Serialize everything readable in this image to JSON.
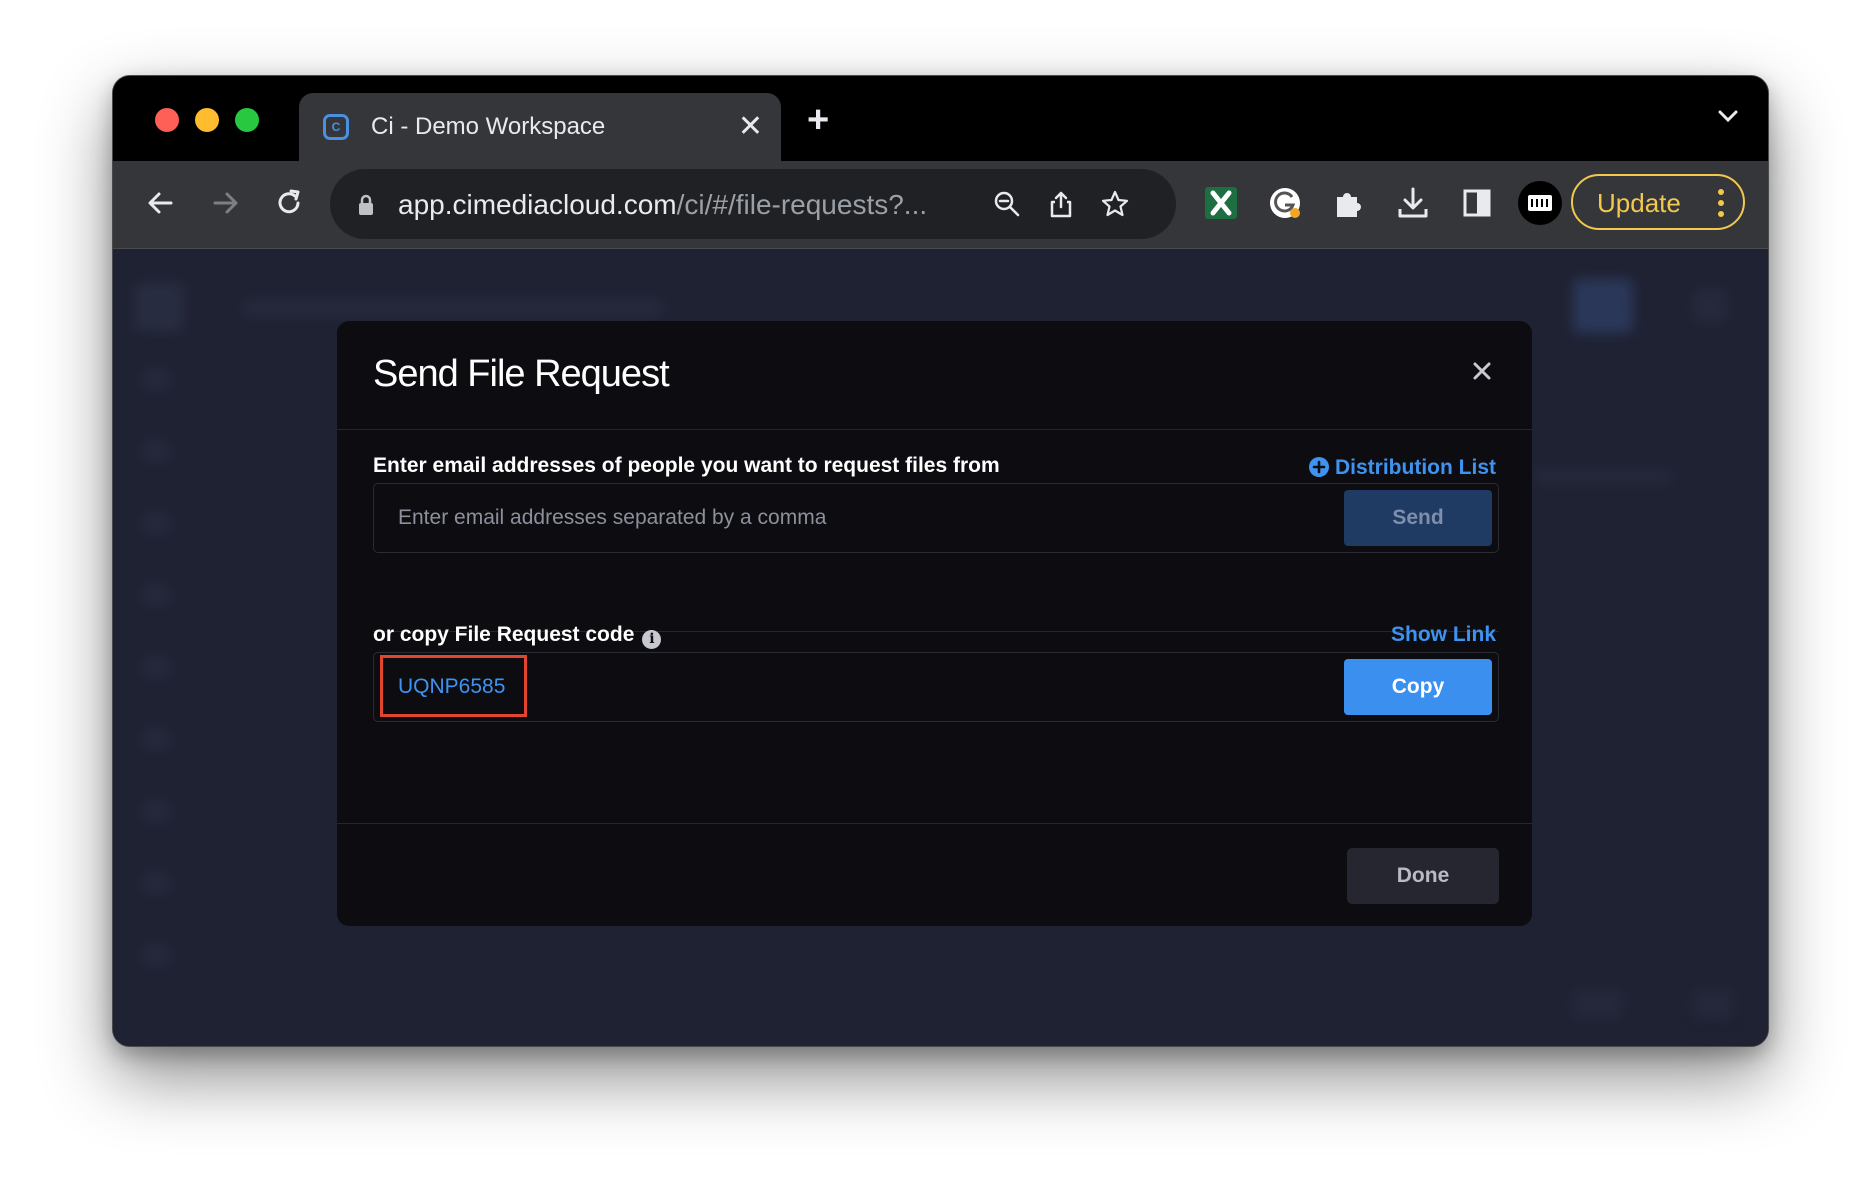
{
  "browser": {
    "tab": {
      "title": "Ci - Demo Workspace",
      "favicon": "ci-logo-icon"
    },
    "address": {
      "host": "app.cimediacloud.com",
      "path": "/ci/#/file-requests?..."
    },
    "update_label": "Update"
  },
  "modal": {
    "title": "Send File Request",
    "email_section": {
      "label": "Enter email addresses of people you want to request files from",
      "distribution_link": "Distribution List",
      "placeholder": "Enter email addresses separated by a comma",
      "send_label": "Send"
    },
    "code_section": {
      "label": "or copy File Request code",
      "show_link": "Show Link",
      "code": "UQNP6585",
      "copy_label": "Copy"
    },
    "done_label": "Done"
  },
  "colors": {
    "accent": "#3b8fee",
    "link": "#3f93f0",
    "highlight": "#e1442f",
    "update": "#f2c94c"
  }
}
